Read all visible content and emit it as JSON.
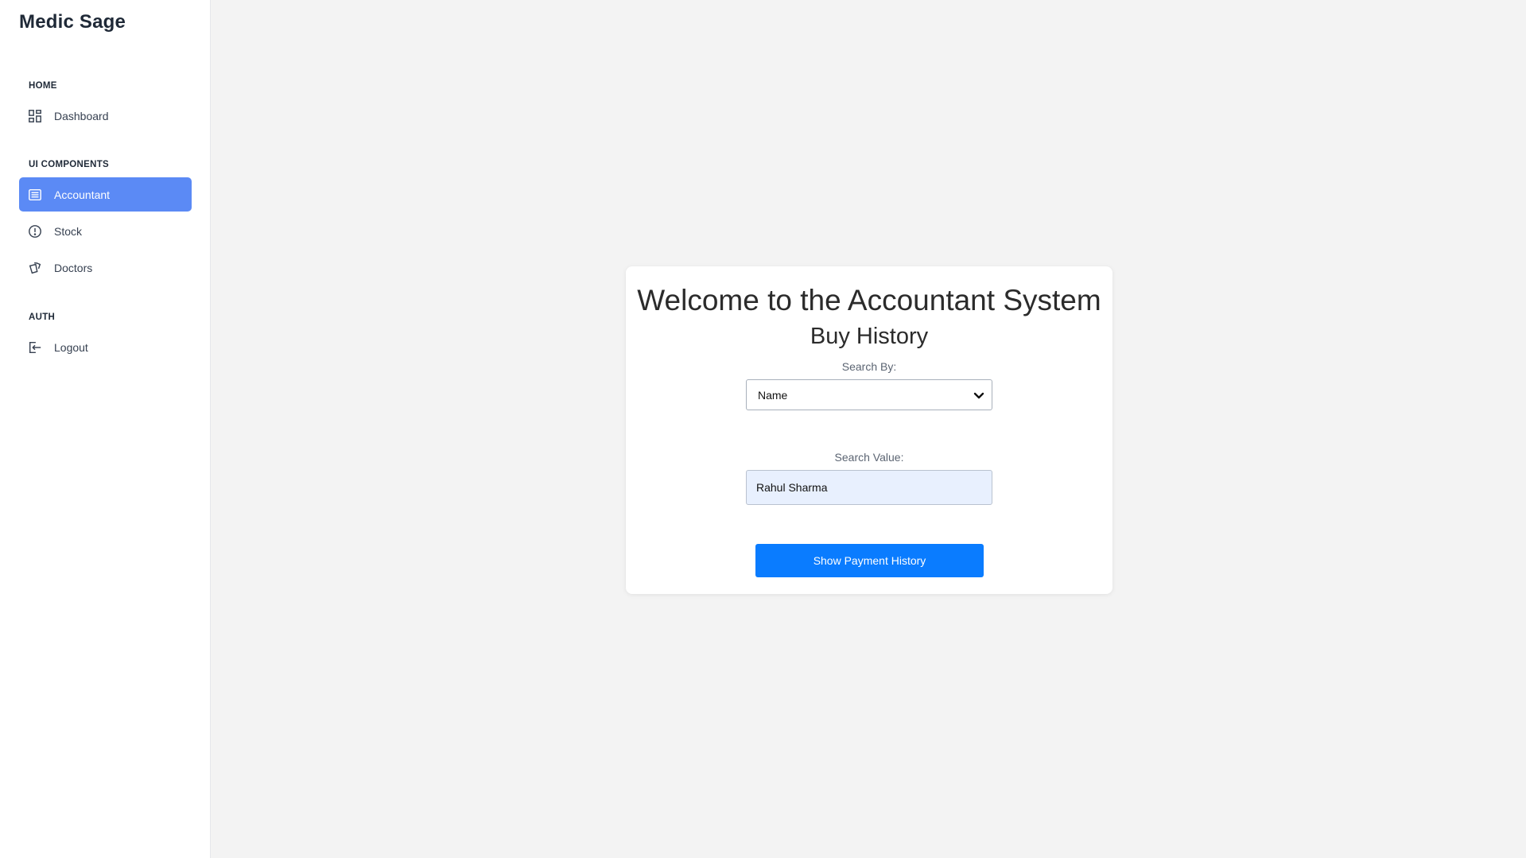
{
  "app": {
    "brand": "Medic Sage"
  },
  "sidebar": {
    "sections": [
      {
        "title": "HOME",
        "items": [
          {
            "label": "Dashboard",
            "icon": "dashboard-grid-icon",
            "active": false
          }
        ]
      },
      {
        "title": "UI COMPONENTS",
        "items": [
          {
            "label": "Accountant",
            "icon": "list-document-icon",
            "active": true
          },
          {
            "label": "Stock",
            "icon": "alert-circle-icon",
            "active": false
          },
          {
            "label": "Doctors",
            "icon": "cards-icon",
            "active": false
          }
        ]
      },
      {
        "title": "AUTH",
        "items": [
          {
            "label": "Logout",
            "icon": "logout-icon",
            "active": false
          }
        ]
      }
    ]
  },
  "main": {
    "title": "Welcome to the Accountant System",
    "subtitle": "Buy History",
    "search_by": {
      "label": "Search By:",
      "selected": "Name"
    },
    "search_value": {
      "label": "Search Value:",
      "value": "Rahul Sharma"
    },
    "submit_label": "Show Payment History"
  },
  "colors": {
    "accent": "#5b8af5",
    "primary_button": "#0a7cff",
    "background": "#f3f3f3",
    "input_fill": "#e8f0fe"
  }
}
